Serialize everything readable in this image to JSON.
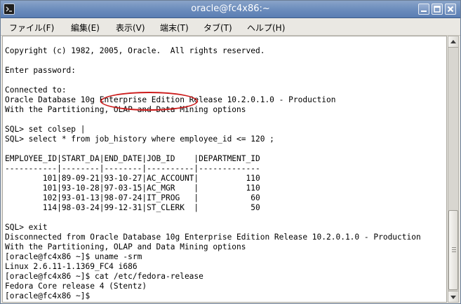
{
  "window": {
    "title": "oracle@fc4x86:~"
  },
  "menubar": {
    "items": [
      {
        "label": "ファイル(F)"
      },
      {
        "label": "編集(E)"
      },
      {
        "label": "表示(V)"
      },
      {
        "label": "端末(T)"
      },
      {
        "label": "タブ(T)"
      },
      {
        "label": "ヘルプ(H)"
      }
    ]
  },
  "terminal": {
    "lines": [
      "Copyright (c) 1982, 2005, Oracle.  All rights reserved.",
      "",
      "Enter password:",
      "",
      "Connected to:",
      "Oracle Database 10g Enterprise Edition Release 10.2.0.1.0 - Production",
      "With the Partitioning, OLAP and Data Mining options",
      "",
      "SQL> set colsep |",
      "SQL> select * from job_history where employee_id <= 120 ;",
      "",
      "EMPLOYEE_ID|START_DA|END_DATE|JOB_ID    |DEPARTMENT_ID",
      "-----------|--------|--------|----------|-------------",
      "        101|89-09-21|93-10-27|AC_ACCOUNT|          110",
      "        101|93-10-28|97-03-15|AC_MGR    |          110",
      "        102|93-01-13|98-07-24|IT_PROG   |           60",
      "        114|98-03-24|99-12-31|ST_CLERK  |           50",
      "",
      "SQL> exit",
      "Disconnected from Oracle Database 10g Enterprise Edition Release 10.2.0.1.0 - Production",
      "With the Partitioning, OLAP and Data Mining options",
      "[oracle@fc4x86 ~]$ uname -srm",
      "Linux 2.6.11-1.1369_FC4 i686",
      "[oracle@fc4x86 ~]$ cat /etc/fedora-release",
      "Fedora Core release 4 (Stentz)",
      "[oracle@fc4x86 ~]$"
    ]
  },
  "colors": {
    "titlebar": "#6f8fbe",
    "annotation": "#cc1b1b",
    "terminal_bg": "#ffffff",
    "terminal_fg": "#000000"
  },
  "icons": {
    "app": "terminal-icon",
    "minimize": "minimize-icon",
    "maximize": "maximize-icon",
    "close": "close-icon"
  }
}
